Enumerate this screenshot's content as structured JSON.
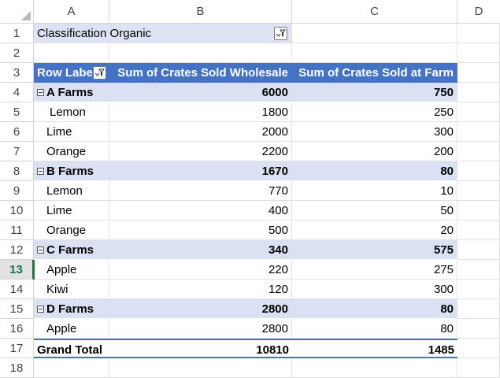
{
  "columns": [
    "A",
    "B",
    "C",
    "D"
  ],
  "rows": [
    "1",
    "2",
    "3",
    "4",
    "5",
    "6",
    "7",
    "8",
    "9",
    "10",
    "11",
    "12",
    "13",
    "14",
    "15",
    "16",
    "17",
    "18"
  ],
  "filter": {
    "label": "Classification Organic"
  },
  "header": {
    "row_labels": "Row Labels",
    "col_wholesale": "Sum of Crates Sold Wholesale",
    "col_farm": "Sum of Crates Sold at Farm"
  },
  "data_rows": [
    {
      "label": "A Farms",
      "wholesale": "6000",
      "farm": "750"
    },
    {
      "label": "Lemon",
      "wholesale": "1800",
      "farm": "250"
    },
    {
      "label": "Lime",
      "wholesale": "2000",
      "farm": "300"
    },
    {
      "label": "Orange",
      "wholesale": "2200",
      "farm": "200"
    },
    {
      "label": "B Farms",
      "wholesale": "1670",
      "farm": "80"
    },
    {
      "label": "Lemon",
      "wholesale": "770",
      "farm": "10"
    },
    {
      "label": "Lime",
      "wholesale": "400",
      "farm": "50"
    },
    {
      "label": "Orange",
      "wholesale": "500",
      "farm": "20"
    },
    {
      "label": "C Farms",
      "wholesale": "340",
      "farm": "575"
    },
    {
      "label": "Apple",
      "wholesale": "220",
      "farm": "275"
    },
    {
      "label": "Kiwi",
      "wholesale": "120",
      "farm": "300"
    },
    {
      "label": "D Farms",
      "wholesale": "2800",
      "farm": "80"
    },
    {
      "label": "Apple",
      "wholesale": "2800",
      "farm": "80"
    }
  ],
  "grand_total": {
    "label": "Grand Total",
    "wholesale": "10810",
    "farm": "1485"
  },
  "active_row": "13",
  "colors": {
    "accent": "#4472c4",
    "group_fill": "#d9e1f2",
    "filter_fill": "#dde3f2",
    "active_header": "#217346"
  }
}
